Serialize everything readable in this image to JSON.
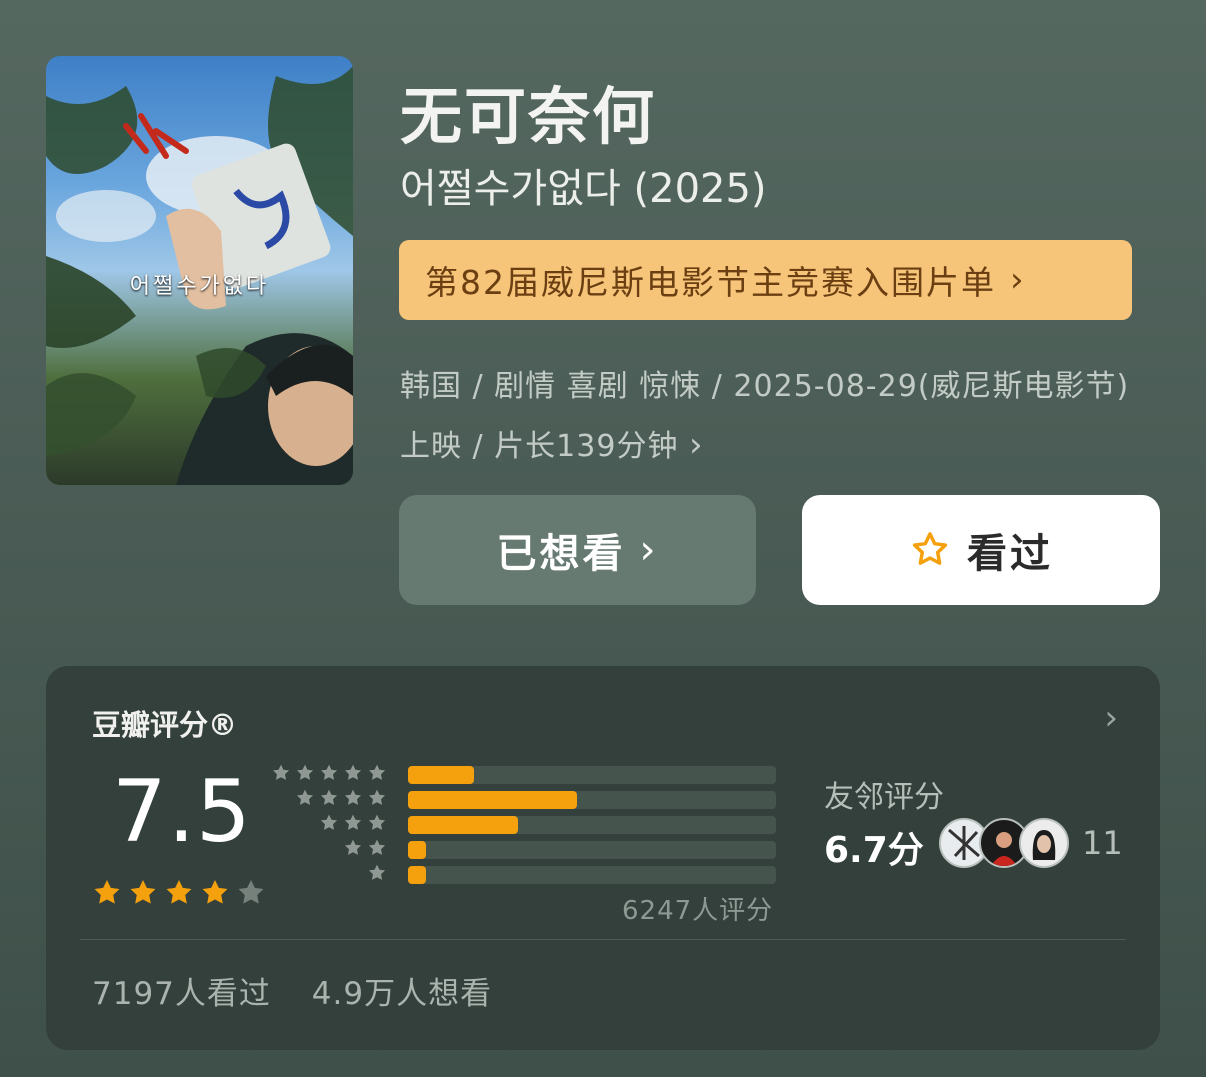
{
  "movie": {
    "title": "无可奈何",
    "original_title": "어쩔수가없다 (2025)",
    "poster_title": "어쩔수가없다",
    "award": "第82届威尼斯电影节主竞赛入围片单",
    "meta": "韩国 / 剧情 喜剧 惊悚 / 2025-08-29(威尼斯电影节) 上映 / 片长139分钟",
    "meta_chevron": "›"
  },
  "actions": {
    "wish_label": "已想看",
    "wish_chevron": "›",
    "seen_label": "看过",
    "seen_icon": "star-outline-icon",
    "seen_icon_color": "#f5a10e"
  },
  "rating": {
    "header": "豆瓣评分®",
    "header_chevron": "›",
    "score": "7.5",
    "stars": 4,
    "star_color": "#f5a10e",
    "distribution": [
      {
        "stars": 5,
        "fraction": 0.18
      },
      {
        "stars": 4,
        "fraction": 0.46
      },
      {
        "stars": 3,
        "fraction": 0.3
      },
      {
        "stars": 2,
        "fraction": 0.05
      },
      {
        "stars": 1,
        "fraction": 0.05
      }
    ],
    "rating_count": "6247人评分",
    "friends_label": "友邻评分",
    "friends_score": "6.7分",
    "friends_count": "11",
    "seen_count": "7197人看过",
    "wish_count": "4.9万人想看"
  }
}
